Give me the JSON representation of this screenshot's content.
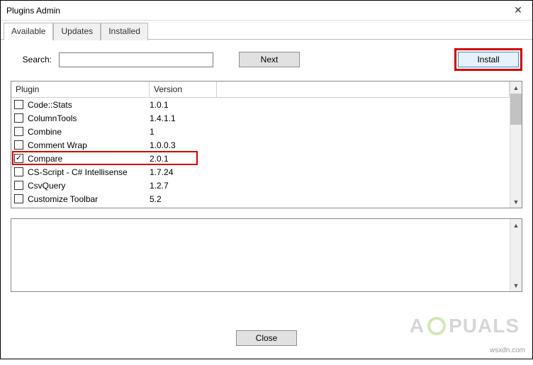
{
  "window": {
    "title": "Plugins Admin"
  },
  "tabs": [
    {
      "label": "Available",
      "active": true
    },
    {
      "label": "Updates",
      "active": false
    },
    {
      "label": "Installed",
      "active": false
    }
  ],
  "search": {
    "label": "Search:",
    "value": "",
    "next_label": "Next"
  },
  "install": {
    "label": "Install"
  },
  "columns": {
    "plugin": "Plugin",
    "version": "Version"
  },
  "plugins": [
    {
      "name": "Code::Stats",
      "version": "1.0.1",
      "checked": false
    },
    {
      "name": "ColumnTools",
      "version": "1.4.1.1",
      "checked": false
    },
    {
      "name": "Combine",
      "version": "1",
      "checked": false
    },
    {
      "name": "Comment Wrap",
      "version": "1.0.0.3",
      "checked": false
    },
    {
      "name": "Compare",
      "version": "2.0.1",
      "checked": true,
      "highlighted": true
    },
    {
      "name": "CS-Script - C# Intellisense",
      "version": "1.7.24",
      "checked": false
    },
    {
      "name": "CsvQuery",
      "version": "1.2.7",
      "checked": false
    },
    {
      "name": "Customize Toolbar",
      "version": "5.2",
      "checked": false
    }
  ],
  "footer": {
    "close_label": "Close"
  },
  "watermark": {
    "pre": "A",
    "post": "PUALS"
  },
  "attribution": "wsxdn.com"
}
